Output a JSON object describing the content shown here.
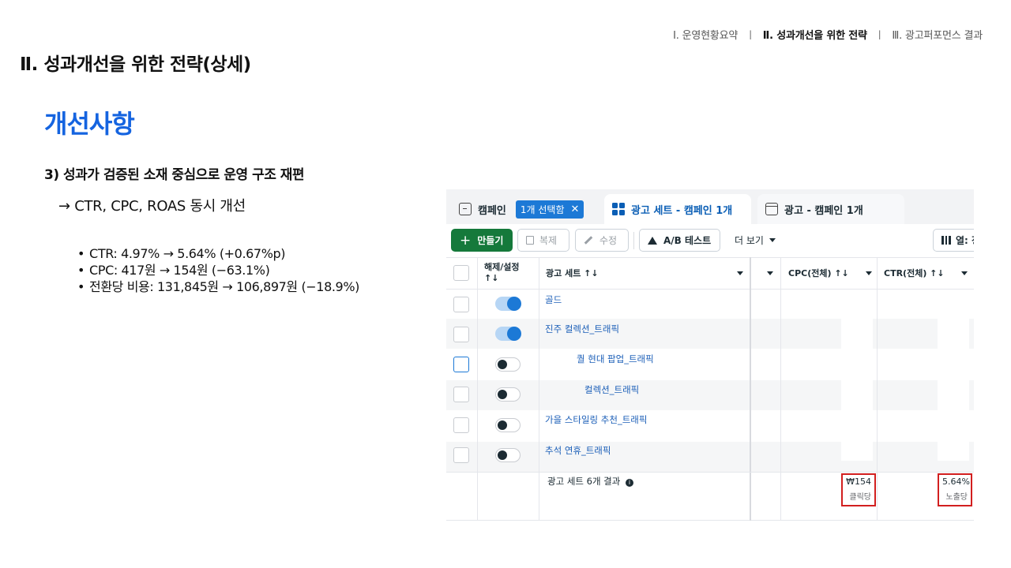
{
  "nav": {
    "item1": "Ⅰ. 운영현황요약",
    "item2": "Ⅱ. 성과개선을 위한 전략",
    "item3": "Ⅲ. 광고퍼포먼스 결과",
    "sep": "ㅣ"
  },
  "slide_title": "Ⅱ. 성과개선을 위한 전략(상세)",
  "section_heading": "개선사항",
  "point": {
    "title": "3) 성과가 검증된 소재 중심으로 운영 구조 재편",
    "subtitle": "→ CTR, CPC, ROAS 동시 개선",
    "bullets": [
      "CTR: 4.97% → 5.64% (+0.67%p)",
      "CPC: 417원 → 154원 (−63.1%)",
      "전환당 비용: 131,845원 → 106,897원 (−18.9%)"
    ]
  },
  "ads_manager": {
    "tabs": {
      "campaign": "캠페인",
      "selected_chip": "1개 선택함",
      "adset": "광고 세트 - 캠페인 1개",
      "ad": "광고 - 캠페인 1개"
    },
    "toolbar": {
      "create": "만들기",
      "duplicate": "복제",
      "edit": "수정",
      "ab_test": "A/B 테스트",
      "more": "더 보기",
      "columns": "열: 정"
    },
    "headers": {
      "toggle": "해제/설정 ↑↓",
      "adset_name": "광고 세트 ↑↓",
      "cpc": "CPC(전체) ↑↓",
      "ctr": "CTR(전체) ↑↓"
    },
    "rows": [
      {
        "name": "골드",
        "on": true
      },
      {
        "name": "진주 컬렉션_트래픽",
        "on": true
      },
      {
        "name": "퀄 현대 팝업_트래픽",
        "on": false
      },
      {
        "name": "컬렉션_트래픽",
        "on": false
      },
      {
        "name": "가을 스타일링 추천_트래픽",
        "on": false
      },
      {
        "name": "추석 연휴_트래픽",
        "on": false
      }
    ],
    "summary": {
      "label": "광고 세트 6개 결과",
      "cpc_value": "₩154",
      "cpc_sub": "클릭당",
      "ctr_value": "5.64%",
      "ctr_sub": "노출당"
    },
    "colors": {
      "accent": "#1c79d6",
      "create_button": "#15793b",
      "highlight_box": "#d21f1f",
      "heading_blue": "#1564e0"
    }
  }
}
